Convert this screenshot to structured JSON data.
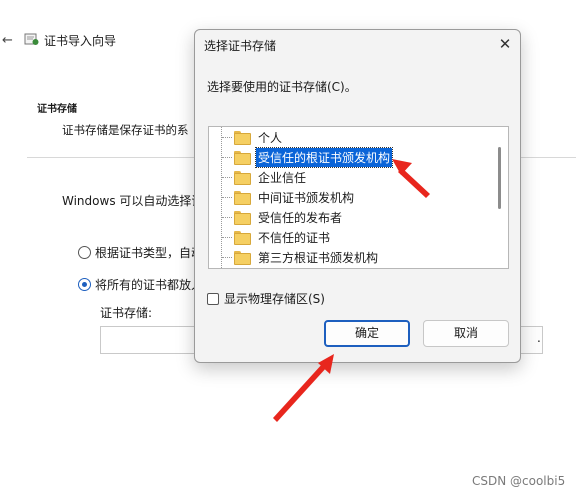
{
  "wizard": {
    "back_glyph": "←",
    "title": "证书导入向导",
    "section_title": "证书存储",
    "section_subtitle": "证书存储是保存证书的系",
    "auto_text": "Windows 可以自动选择证",
    "radio_auto": "根据证书类型，自动",
    "radio_manual": "将所有的证书都放入",
    "store_label": "证书存储:",
    "browse_glyph": "."
  },
  "dialog": {
    "title": "选择证书存储",
    "close_glyph": "✕",
    "prompt": "选择要使用的证书存储(C)。",
    "stores": [
      {
        "label": "个人",
        "selected": false
      },
      {
        "label": "受信任的根证书颁发机构",
        "selected": true
      },
      {
        "label": "企业信任",
        "selected": false
      },
      {
        "label": "中间证书颁发机构",
        "selected": false
      },
      {
        "label": "受信任的发布者",
        "selected": false
      },
      {
        "label": "不信任的证书",
        "selected": false
      },
      {
        "label": "第三方根证书颁发机构",
        "selected": false
      }
    ],
    "show_physical": "显示物理存储区(S)",
    "ok": "确定",
    "cancel": "取消"
  },
  "annotation_color": "#e8261d",
  "icons": {
    "folder": "folder-icon",
    "close": "close-icon",
    "back": "back-arrow-icon",
    "wizard": "certificate-icon"
  },
  "watermark": "CSDN @coolbi5"
}
